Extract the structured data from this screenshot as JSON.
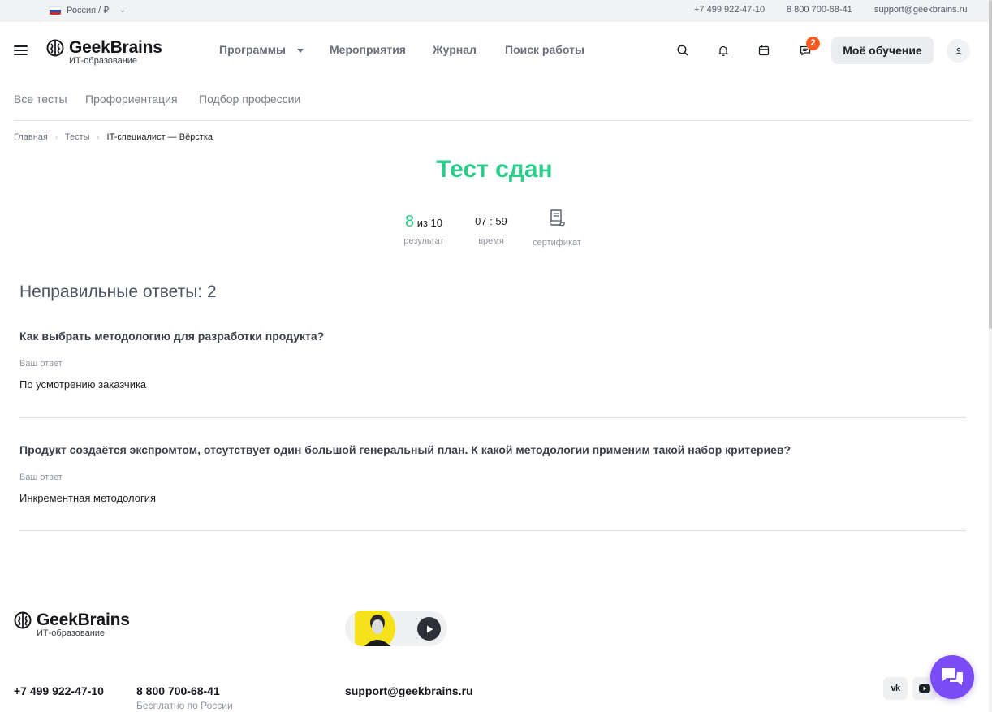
{
  "topbar": {
    "region": "Россия / ₽",
    "phone1": "+7 499 922-47-10",
    "phone2": "8 800 700-68-41",
    "email": "support@geekbrains.ru"
  },
  "header": {
    "logo_name": "GeekBrains",
    "logo_sub": "ИТ-образование",
    "nav": [
      "Программы",
      "Мероприятия",
      "Журнал",
      "Поиск работы"
    ],
    "notification_count": "2",
    "my_learning": "Моё обучение"
  },
  "subnav": [
    "Все тесты",
    "Профориентация",
    "Подбор профессии"
  ],
  "breadcrumbs": [
    "Главная",
    "Тесты",
    "IT-специалист — Вёрстка"
  ],
  "result": {
    "title": "Тест сдан",
    "score": "8",
    "score_total": "из 10",
    "score_label": "результат",
    "time": "07 : 59",
    "time_label": "время",
    "certificate_label": "сертификат"
  },
  "wrong": {
    "title": "Неправильные ответы: 2",
    "items": [
      {
        "question": "Как выбрать методологию для разработки продукта?",
        "your_answer_label": "Ваш ответ",
        "answer": "По усмотрению заказчика"
      },
      {
        "question": "Продукт создаётся экспромтом, отсутствует один большой генеральный план. К какой методологии применим такой набор критериев?",
        "your_answer_label": "Ваш ответ",
        "answer": "Инкрементная методология"
      }
    ]
  },
  "footer": {
    "logo_name": "GeekBrains",
    "logo_sub": "ИТ-образование",
    "phone1": "+7 499 922-47-10",
    "phone2": "8 800 700-68-41",
    "phone2_note": "Бесплатно по России",
    "email": "support@geekbrains.ru"
  },
  "colors": {
    "accent_green": "#2ccc8b",
    "badge_orange": "#ff5a1f",
    "chat_purple": "#7a4cf5"
  }
}
